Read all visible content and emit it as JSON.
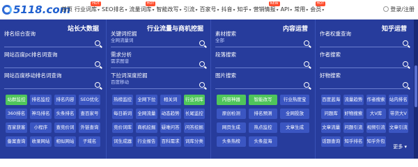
{
  "logo": {
    "text": "5118.com"
  },
  "nav": {
    "items": [
      {
        "label": "首页",
        "caret": false,
        "hot": ""
      },
      {
        "label": "行业词库",
        "caret": true,
        "hot": "HOT"
      },
      {
        "label": "SEO排名",
        "caret": true,
        "hot": ""
      },
      {
        "label": "流量词库",
        "caret": true,
        "hot": "HOT"
      },
      {
        "label": "智能改写",
        "caret": true,
        "hot": ""
      },
      {
        "label": "引流",
        "caret": true,
        "hot": ""
      },
      {
        "label": "百家号",
        "caret": true,
        "hot": ""
      },
      {
        "label": "抖音",
        "caret": true,
        "hot": ""
      },
      {
        "label": "知乎",
        "caret": true,
        "hot": ""
      },
      {
        "label": "营销情报",
        "caret": true,
        "hot": "NEW"
      },
      {
        "label": "API",
        "caret": true,
        "hot": ""
      },
      {
        "label": "常用",
        "caret": true,
        "hot": ""
      },
      {
        "label": "会员",
        "caret": true,
        "hot": "HOT"
      }
    ],
    "user": "登录/注册"
  },
  "columns": [
    {
      "title": "站长大数据",
      "fields": [
        {
          "label": "排名综合查询",
          "sub": ""
        },
        {
          "label": "网站百度pc排名词查询",
          "sub": ""
        },
        {
          "label": "网站百度移动排名词查询",
          "sub": ""
        }
      ],
      "buttons": [
        {
          "label": "站群监控",
          "green": true
        },
        {
          "label": "排名监控",
          "green": false
        },
        {
          "label": "排名内容",
          "green": false
        },
        {
          "label": "SEO优化",
          "green": false
        },
        {
          "label": "360排名",
          "green": false
        },
        {
          "label": "神马排名",
          "green": false
        },
        {
          "label": "头条排名",
          "green": false
        },
        {
          "label": "查百家号",
          "green": false
        },
        {
          "label": "百家获客",
          "green": false
        },
        {
          "label": "小程序",
          "green": false
        },
        {
          "label": "查竞价词",
          "green": false
        },
        {
          "label": "外链查询",
          "green": false
        },
        {
          "label": "备案查询",
          "green": false
        },
        {
          "label": "收录网站",
          "green": false
        },
        {
          "label": "相似网站",
          "green": false
        },
        {
          "label": "子域名",
          "green": false
        }
      ],
      "more": ""
    },
    {
      "title": "行业流量与商机挖掘",
      "fields": [
        {
          "label": "关键词挖掘",
          "sub": "全网流量词"
        },
        {
          "label": "需求分析",
          "sub": "需求图谱"
        },
        {
          "label": "下拉词深度挖掘",
          "sub": "百度移动"
        }
      ],
      "buttons": [
        {
          "label": "热榜监控",
          "green": false
        },
        {
          "label": "全网下拉",
          "green": false
        },
        {
          "label": "相关词",
          "green": false
        },
        {
          "label": "行业词库",
          "green": true
        },
        {
          "label": "每日新词",
          "green": false
        },
        {
          "label": "全网流量",
          "green": false
        },
        {
          "label": "动态趋势",
          "green": false
        },
        {
          "label": "长尾监控",
          "green": false
        },
        {
          "label": "竞价词库",
          "green": false
        },
        {
          "label": "商机挖掘",
          "green": false
        },
        {
          "label": "疑难问答",
          "green": false
        },
        {
          "label": "问答挖掘",
          "green": false
        },
        {
          "label": "词生成器",
          "green": false
        },
        {
          "label": "行业报告",
          "green": false
        },
        {
          "label": "百科需求",
          "green": false
        },
        {
          "label": "词库分类",
          "green": false
        }
      ],
      "more": ""
    },
    {
      "title": "内容运营",
      "fields": [
        {
          "label": "素材搜索",
          "sub": "全部"
        },
        {
          "label": "段落搜索",
          "sub": ""
        },
        {
          "label": "图片搜索",
          "sub": ""
        }
      ],
      "buttons": [
        {
          "label": "内容神器",
          "green": true
        },
        {
          "label": "智能改写",
          "green": true
        },
        {
          "label": "行业热度宝",
          "green": false
        },
        {
          "label": "原创检测",
          "green": false
        },
        {
          "label": "排名预测",
          "green": false
        },
        {
          "label": "全网投放",
          "green": false
        },
        {
          "label": "网页生成",
          "green": false
        },
        {
          "label": "热点监控",
          "green": false
        },
        {
          "label": "文章生成",
          "green": false
        },
        {
          "label": "头条热榜",
          "green": false
        },
        {
          "label": "头条蓝海",
          "green": false
        }
      ],
      "more": ""
    },
    {
      "title": "知乎运营",
      "fields": [
        {
          "label": "作者权重查询",
          "sub": ""
        },
        {
          "label": "作者搜索",
          "sub": ""
        },
        {
          "label": "好物搜索",
          "sub": ""
        }
      ],
      "buttons": [
        {
          "label": "百度蓝海",
          "green": false
        },
        {
          "label": "流量趋势",
          "green": false
        },
        {
          "label": "作者搜索",
          "green": false
        },
        {
          "label": "站内排名",
          "green": false
        },
        {
          "label": "问题库",
          "green": false
        },
        {
          "label": "好物搜索",
          "green": false
        },
        {
          "label": "大V库",
          "green": false
        },
        {
          "label": "带货大V",
          "green": false
        },
        {
          "label": "文章流量",
          "green": false
        },
        {
          "label": "问题引流",
          "green": false
        },
        {
          "label": "视频引流",
          "green": false
        },
        {
          "label": "文章引流",
          "green": false
        },
        {
          "label": "话题查询",
          "green": false
        },
        {
          "label": "知乎排名",
          "green": false
        },
        {
          "label": "知乎外包",
          "green": false
        }
      ],
      "more": "更多 ▾"
    }
  ]
}
